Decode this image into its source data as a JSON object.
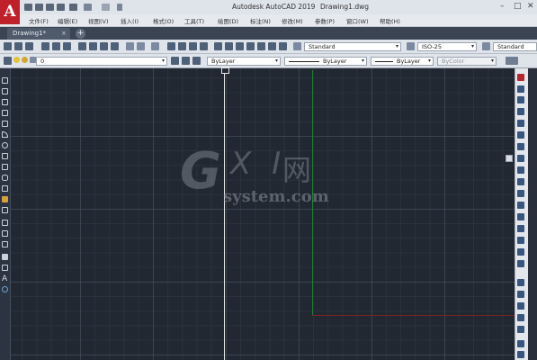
{
  "titlebar": {
    "app_name": "Autodesk AutoCAD 2019",
    "file_name": "Drawing1.dwg",
    "minimize": "–",
    "maximize": "□",
    "close": "✕"
  },
  "menubar": [
    "文件(F)",
    "编辑(E)",
    "视图(V)",
    "插入(I)",
    "格式(O)",
    "工具(T)",
    "绘图(D)",
    "标注(N)",
    "修改(M)",
    "参数(P)",
    "窗口(W)",
    "帮助(H)"
  ],
  "tabs": {
    "active": "Drawing1*",
    "close": "×",
    "add": "+"
  },
  "toolbar1": {
    "text_style": "Standard",
    "dim_style": "ISO-25",
    "table_style": "Standard"
  },
  "toolbar2": {
    "layer_name": "0",
    "color": "ByLayer",
    "linetype": "ByLayer",
    "lineweight": "ByLayer",
    "plot_style": "ByColor"
  },
  "watermark": {
    "g": "G",
    "xi": "X I",
    "net": "网",
    "url": "system.com"
  },
  "colors": {
    "canvas_bg": "#212832",
    "ucs_y": "#1f7a38",
    "ucs_x": "#7a2424",
    "brand": "#c0202a"
  }
}
